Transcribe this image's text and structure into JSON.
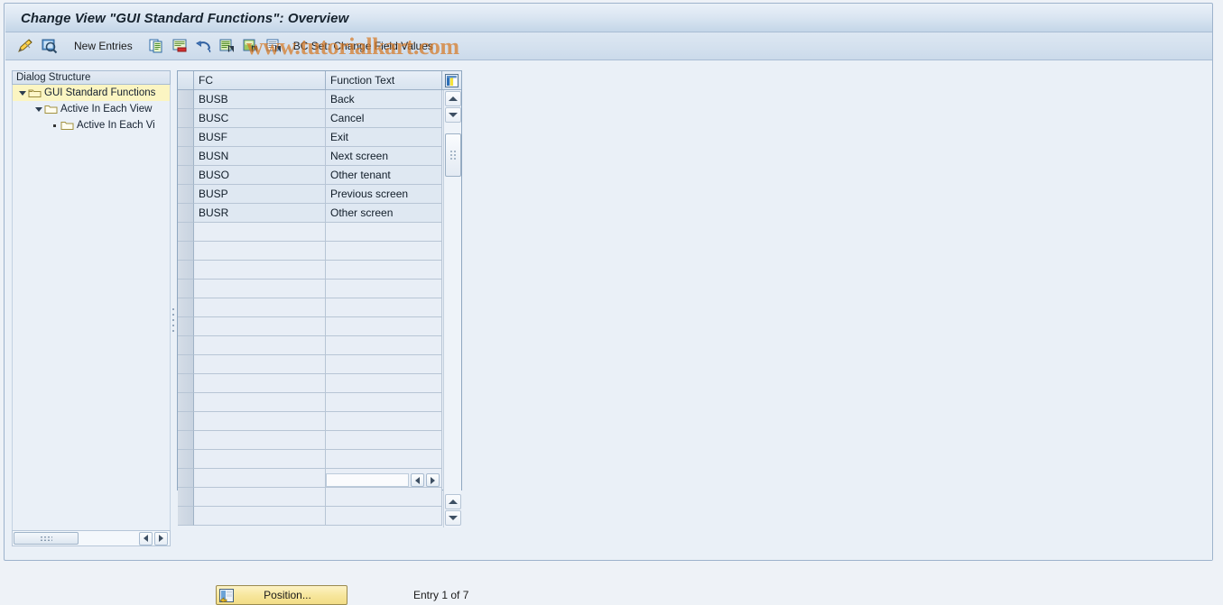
{
  "window": {
    "title": "Change View \"GUI Standard Functions\": Overview"
  },
  "toolbar": {
    "icons_left": [
      {
        "name": "display-change-icon",
        "title": "Display/Change"
      },
      {
        "name": "check-entries-icon",
        "title": "Check Entries"
      }
    ],
    "new_entries_label": "New Entries",
    "icons_mid": [
      {
        "name": "copy-as-icon",
        "title": "Copy As..."
      },
      {
        "name": "delete-icon",
        "title": "Delete"
      },
      {
        "name": "undo-icon",
        "title": "Undo Change"
      },
      {
        "name": "select-all-icon",
        "title": "Select All"
      },
      {
        "name": "select-block-icon",
        "title": "Select Block"
      },
      {
        "name": "deselect-all-icon",
        "title": "Deselect All"
      }
    ],
    "bc_set_label": "BC Set: Change Field Values"
  },
  "watermark": {
    "text": "www.tutorialkart.com"
  },
  "tree": {
    "header": "Dialog Structure",
    "items": [
      {
        "label": "GUI Standard Functions",
        "level": 0,
        "expander": "triangle-down",
        "icon": "folder-open-icon",
        "selected": true
      },
      {
        "label": "Active In Each View",
        "level": 1,
        "expander": "triangle-down",
        "icon": "folder-icon",
        "selected": false
      },
      {
        "label": "Active In Each Vi",
        "level": 2,
        "expander": "dot",
        "icon": "folder-icon",
        "selected": false
      }
    ]
  },
  "table": {
    "columns": [
      "FC",
      "Function  Text"
    ],
    "config_icon": "column-settings-icon",
    "rows": [
      {
        "fc": "BUSB",
        "text": "Back"
      },
      {
        "fc": "BUSC",
        "text": "Cancel"
      },
      {
        "fc": "BUSF",
        "text": "Exit"
      },
      {
        "fc": "BUSN",
        "text": "Next screen"
      },
      {
        "fc": "BUSO",
        "text": "Other tenant"
      },
      {
        "fc": "BUSP",
        "text": "Previous screen"
      },
      {
        "fc": "BUSR",
        "text": "Other screen"
      }
    ],
    "empty_row_count": 16
  },
  "footer": {
    "position_button_label": "Position...",
    "position_button_icon": "position-icon",
    "entry_count": "Entry 1 of 7"
  },
  "colors": {
    "title_bar": "#c4d6e8",
    "toolbar": "#d3e0ee",
    "tree_selected": "#fbf5c2",
    "row_bg": "#dfe8f2",
    "empty_row_bg": "#e8eef6",
    "watermark": "#d67824",
    "button_yellow": "#f7e79e"
  }
}
